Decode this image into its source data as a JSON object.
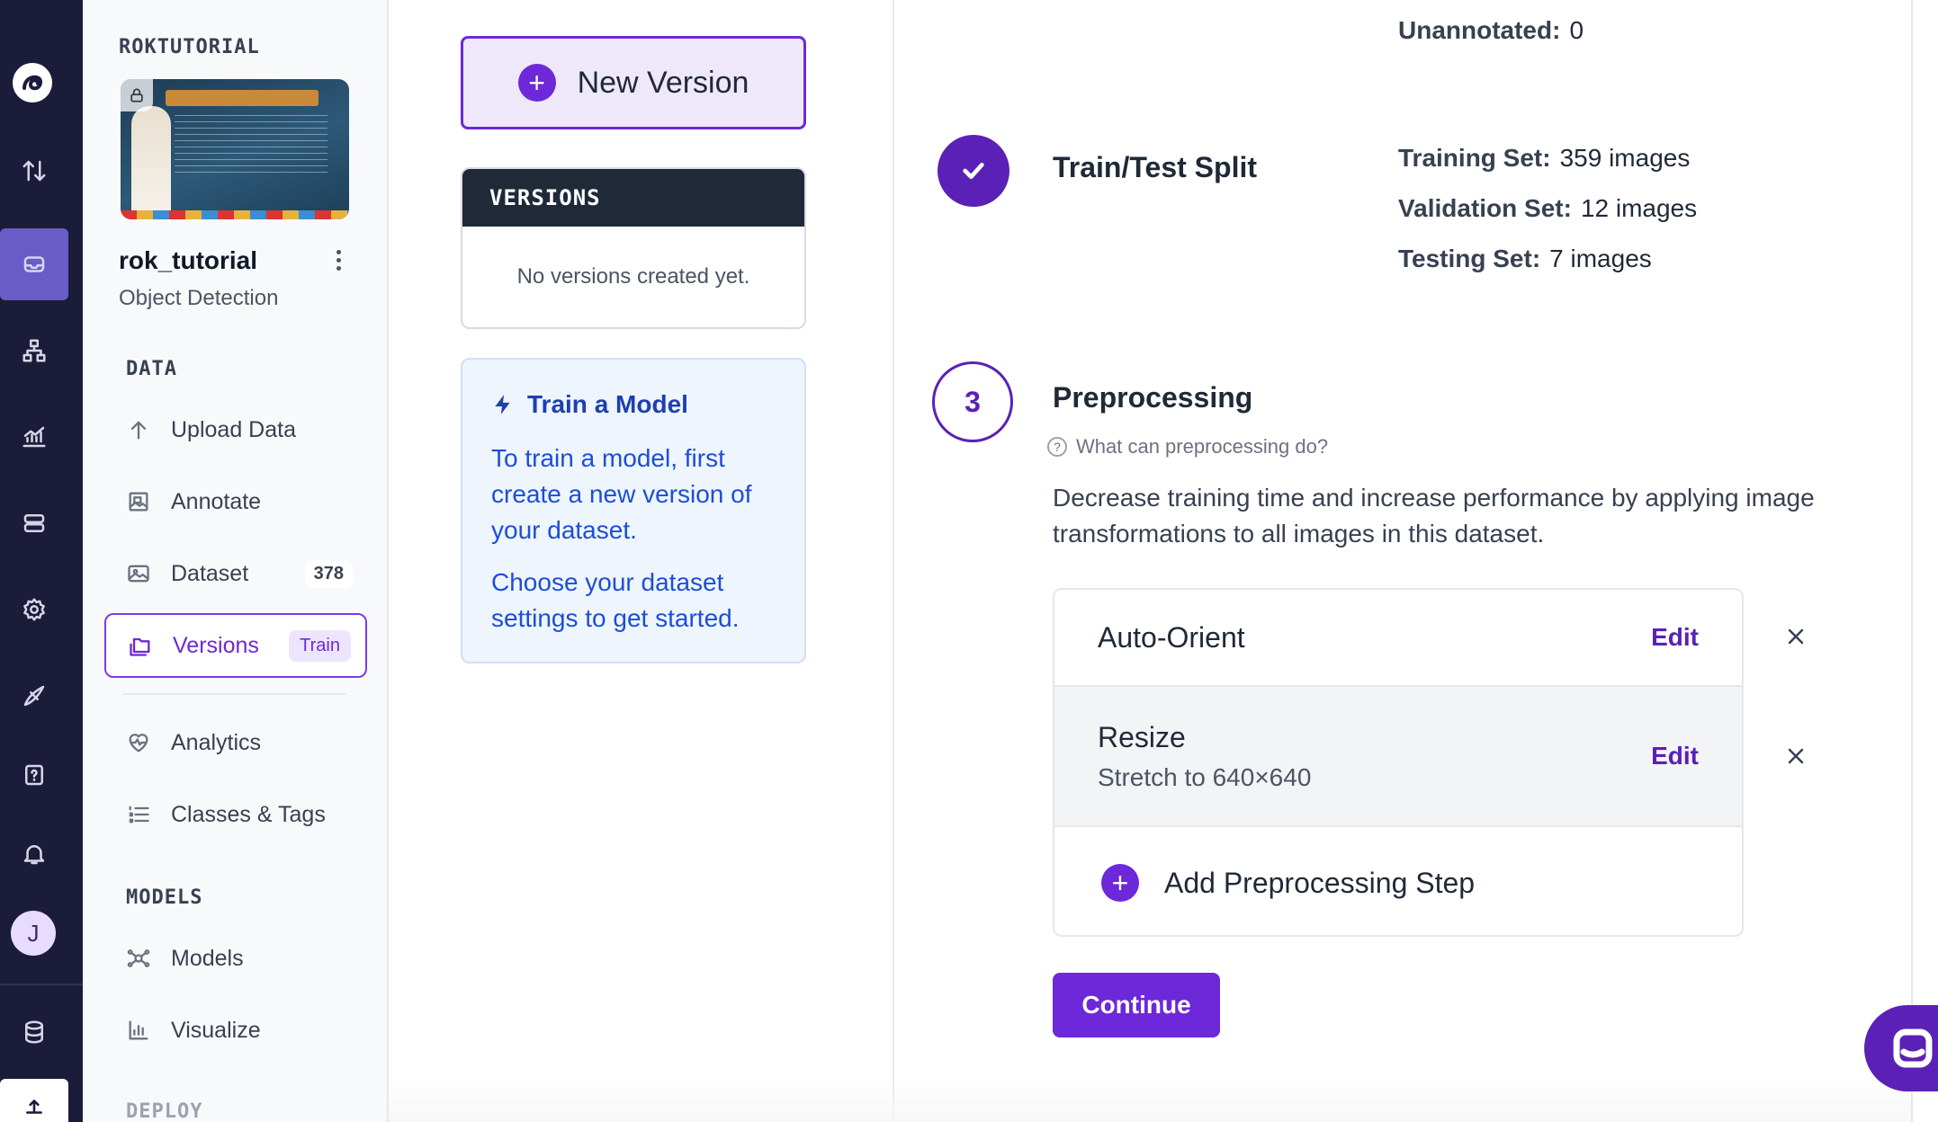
{
  "rail": {
    "avatar_initial": "J",
    "icons": [
      "logo-icon",
      "swap-vertical-icon",
      "inbox-icon",
      "deploy-hierarchy-icon",
      "analytics-icon",
      "server-icon",
      "settings-icon",
      "satellite-icon",
      "help-icon",
      "bell-icon",
      "database-icon",
      "upload-icon"
    ],
    "accent": "#6a5bc7"
  },
  "sidebar": {
    "workspace": "ROKTUTORIAL",
    "project_name": "rok_tutorial",
    "project_type": "Object Detection",
    "data_section": "DATA",
    "models_section": "MODELS",
    "deploy_section": "DEPLOY",
    "items": [
      {
        "label": "Upload Data",
        "icon": "upload-arrow-icon"
      },
      {
        "label": "Annotate",
        "icon": "annotate-icon"
      },
      {
        "label": "Dataset",
        "icon": "image-icon",
        "badge": "378"
      },
      {
        "label": "Versions",
        "icon": "folders-icon",
        "badge": "Train",
        "active": true
      },
      {
        "label": "Analytics",
        "icon": "heart-pulse-icon"
      },
      {
        "label": "Classes & Tags",
        "icon": "list-icon"
      },
      {
        "label": "Models",
        "icon": "nodes-icon"
      },
      {
        "label": "Visualize",
        "icon": "chart-icon"
      }
    ]
  },
  "middle": {
    "new_version_label": "New Version",
    "versions_header": "VERSIONS",
    "versions_empty": "No versions created yet.",
    "train_title": "Train a Model",
    "train_text_1": "To train a model, first create a new version of your dataset.",
    "train_text_2": "Choose your dataset settings to get started."
  },
  "content": {
    "unannotated_label": "Unannotated:",
    "unannotated_value": "0",
    "split_title": "Train/Test Split",
    "training_label": "Training Set:",
    "training_value": "359 images",
    "validation_label": "Validation Set:",
    "validation_value": "12 images",
    "testing_label": "Testing Set:",
    "testing_value": "7 images",
    "preprocessing_step_number": "3",
    "preprocessing_title": "Preprocessing",
    "preprocessing_help": "What can preprocessing do?",
    "preprocessing_desc": "Decrease training time and increase performance by applying image transformations to all images in this dataset.",
    "steps": [
      {
        "name": "Auto-Orient",
        "detail": "",
        "edit": "Edit"
      },
      {
        "name": "Resize",
        "detail": "Stretch to 640×640",
        "edit": "Edit"
      }
    ],
    "add_step_label": "Add Preprocessing Step",
    "continue_label": "Continue",
    "accent": "#6d28d9"
  }
}
